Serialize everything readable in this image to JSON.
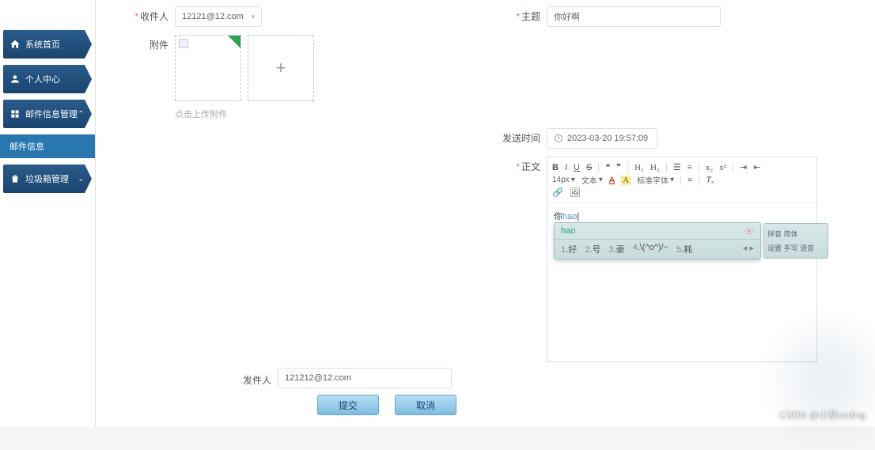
{
  "sidebar": {
    "items": [
      {
        "label": "系统首页",
        "icon": "home-icon"
      },
      {
        "label": "个人中心",
        "icon": "user-icon"
      },
      {
        "label": "邮件信息管理",
        "icon": "grid-icon",
        "expandable": true
      },
      {
        "label": "邮件信息",
        "sub": true
      },
      {
        "label": "垃圾箱管理",
        "icon": "trash-icon",
        "expandable": true
      }
    ]
  },
  "form": {
    "recipient_label": "收件人",
    "recipient_value": "12121@12.com",
    "subject_label": "主题",
    "subject_value": "你好啊",
    "attachment_label": "附件",
    "upload_hint": "点击上传附件",
    "send_time_label": "发送时间",
    "send_time_value": "2023-03-20 19:57:09",
    "body_label": "正文",
    "sender_label": "发件人",
    "sender_value": "121212@12.com"
  },
  "editor": {
    "font_size": "14px",
    "para_format": "文本",
    "font_family": "标准字体",
    "content_prefix": "你",
    "content_typed": "hao"
  },
  "ime": {
    "input": "hao",
    "candidates": [
      {
        "n": "1",
        "t": "好"
      },
      {
        "n": "2",
        "t": "号"
      },
      {
        "n": "3",
        "t": "豪"
      },
      {
        "n": "4",
        "t": "\\(^o^)/~"
      },
      {
        "n": "5",
        "t": "耗"
      }
    ],
    "right_top": "拼音 简体",
    "right_bottom": "设置 手写 语音"
  },
  "buttons": {
    "submit": "提交",
    "cancel": "取消"
  },
  "watermark": "CSDN @小蔡coding"
}
